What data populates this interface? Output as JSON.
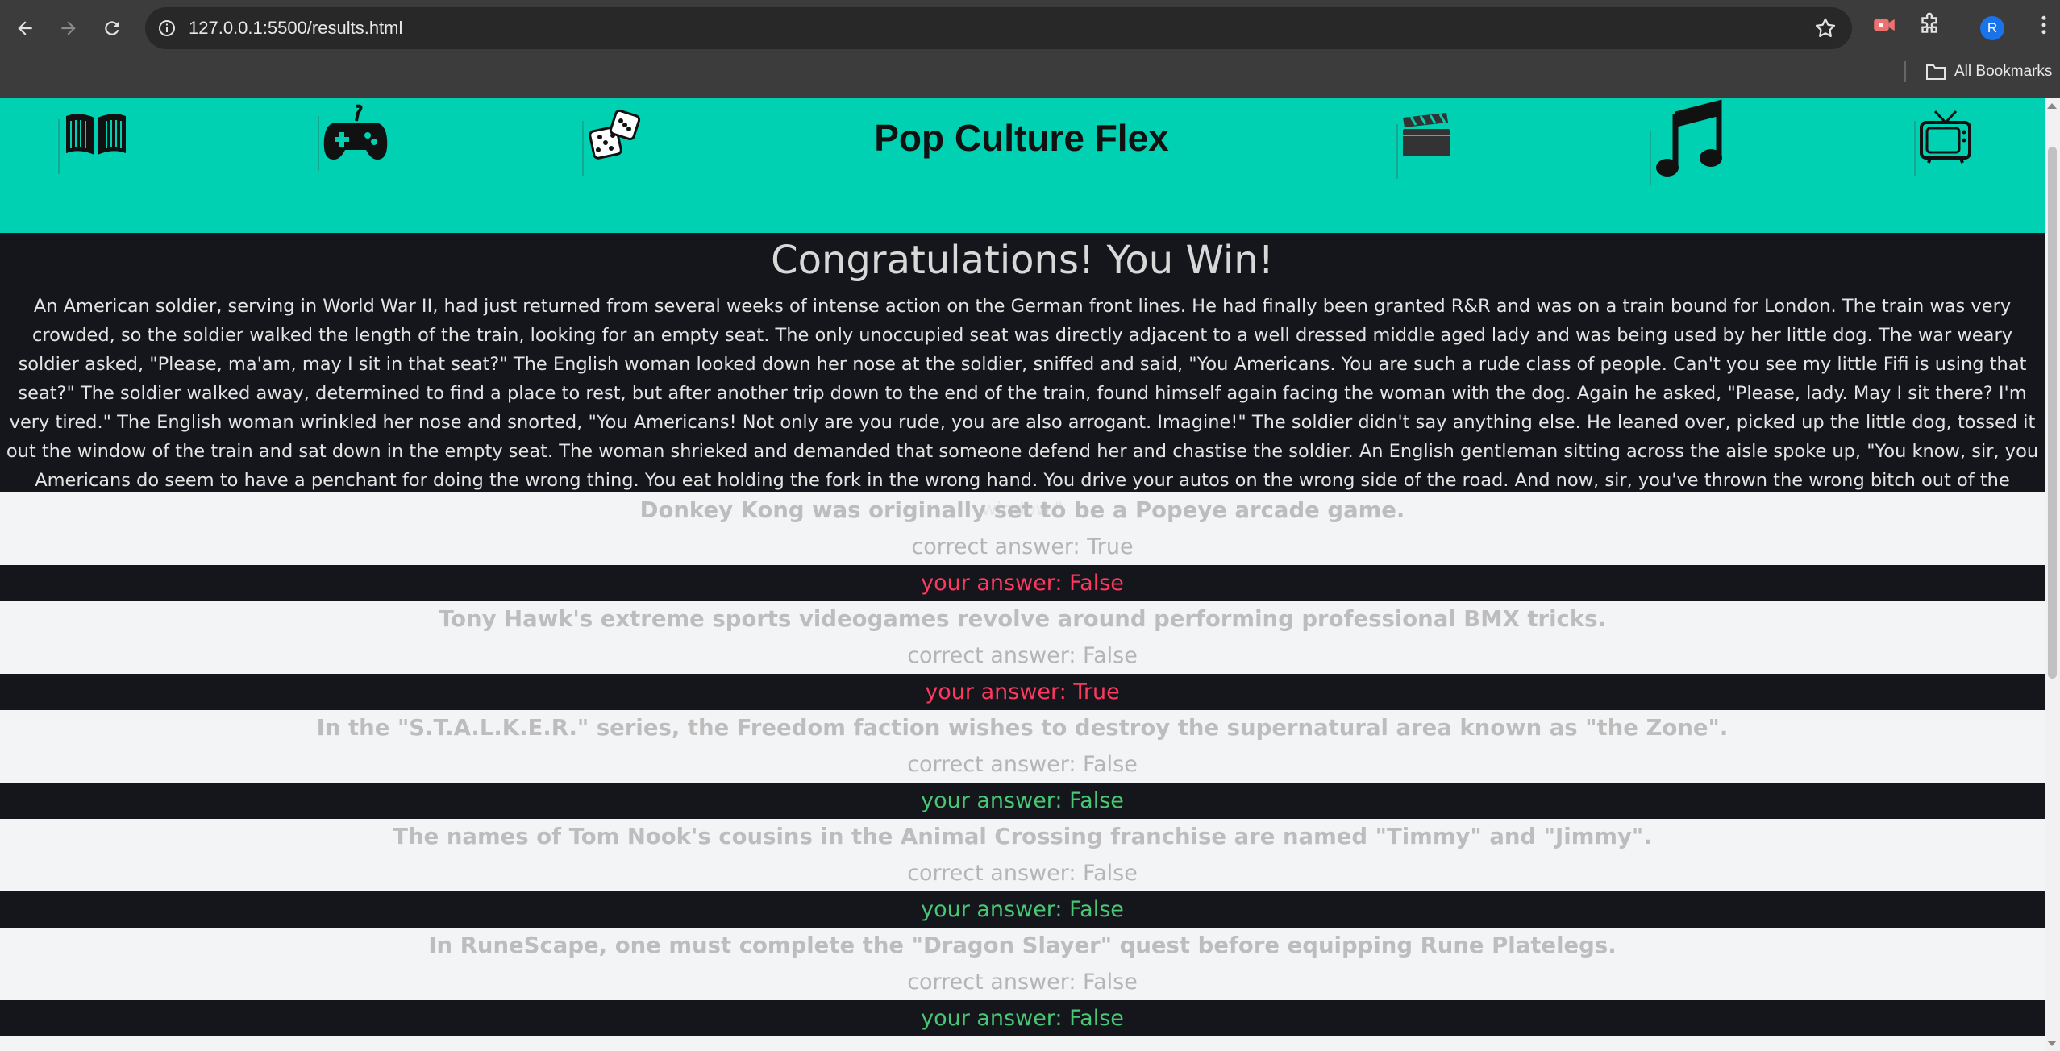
{
  "browser": {
    "url": "127.0.0.1:5500/results.html",
    "profile_initial": "R",
    "bookmarks_label": "All Bookmarks"
  },
  "header": {
    "title": "Pop Culture Flex",
    "icons": [
      "book-icon",
      "gamepad-icon",
      "dice-icon",
      "film-clapper-icon",
      "music-note-icon",
      "tv-icon"
    ],
    "accent": "#00d1b2"
  },
  "result": {
    "heading": "Congratulations! You Win!",
    "joke": "An American soldier, serving in World War II, had just returned from several weeks of intense action on the German front lines. He had finally been granted R&R and was on a train bound for London. The train was very crowded, so the soldier walked the length of the train, looking for an empty seat. The only unoccupied seat was directly adjacent to a well dressed middle aged lady and was being used by her little dog. The war weary soldier asked, \"Please, ma'am, may I sit in that seat?\" The English woman looked down her nose at the soldier, sniffed and said, \"You Americans. You are such a rude class of people. Can't you see my little Fifi is using that seat?\" The soldier walked away, determined to find a place to rest, but after another trip down to the end of the train, found himself again facing the woman with the dog. Again he asked, \"Please, lady. May I sit there? I'm very tired.\" The English woman wrinkled her nose and snorted, \"You Americans! Not only are you rude, you are also arrogant. Imagine!\" The soldier didn't say anything else. He leaned over, picked up the little dog, tossed it out the window of the train and sat down in the empty seat. The woman shrieked and demanded that someone defend her and chastise the soldier. An English gentleman sitting across the aisle spoke up, \"You know, sir, you Americans do seem to have a penchant for doing the wrong thing. You eat holding the fork in the wrong hand. You drive your autos on the wrong side of the road. And now, sir, you've thrown the wrong bitch out of the window.\""
  },
  "questions": [
    {
      "question": "Donkey Kong was originally set to be a Popeye arcade game.",
      "correct": "correct answer: True",
      "yours": "your answer: False",
      "status": "wrong"
    },
    {
      "question": "Tony Hawk's extreme sports videogames revolve around performing professional BMX tricks.",
      "correct": "correct answer: False",
      "yours": "your answer: True",
      "status": "wrong"
    },
    {
      "question": "In the \"S.T.A.L.K.E.R.\" series, the Freedom faction wishes to destroy the supernatural area known as \"the Zone\".",
      "correct": "correct answer: False",
      "yours": "your answer: False",
      "status": "right"
    },
    {
      "question": "The names of Tom Nook's cousins in the Animal Crossing franchise are named \"Timmy\" and \"Jimmy\".",
      "correct": "correct answer: False",
      "yours": "your answer: False",
      "status": "right"
    },
    {
      "question": "In RuneScape, one must complete the \"Dragon Slayer\" quest before equipping Rune Platelegs.",
      "correct": "correct answer: False",
      "yours": "your answer: False",
      "status": "right"
    }
  ],
  "colors": {
    "wrong": "#ff3860",
    "right": "#48c774"
  }
}
